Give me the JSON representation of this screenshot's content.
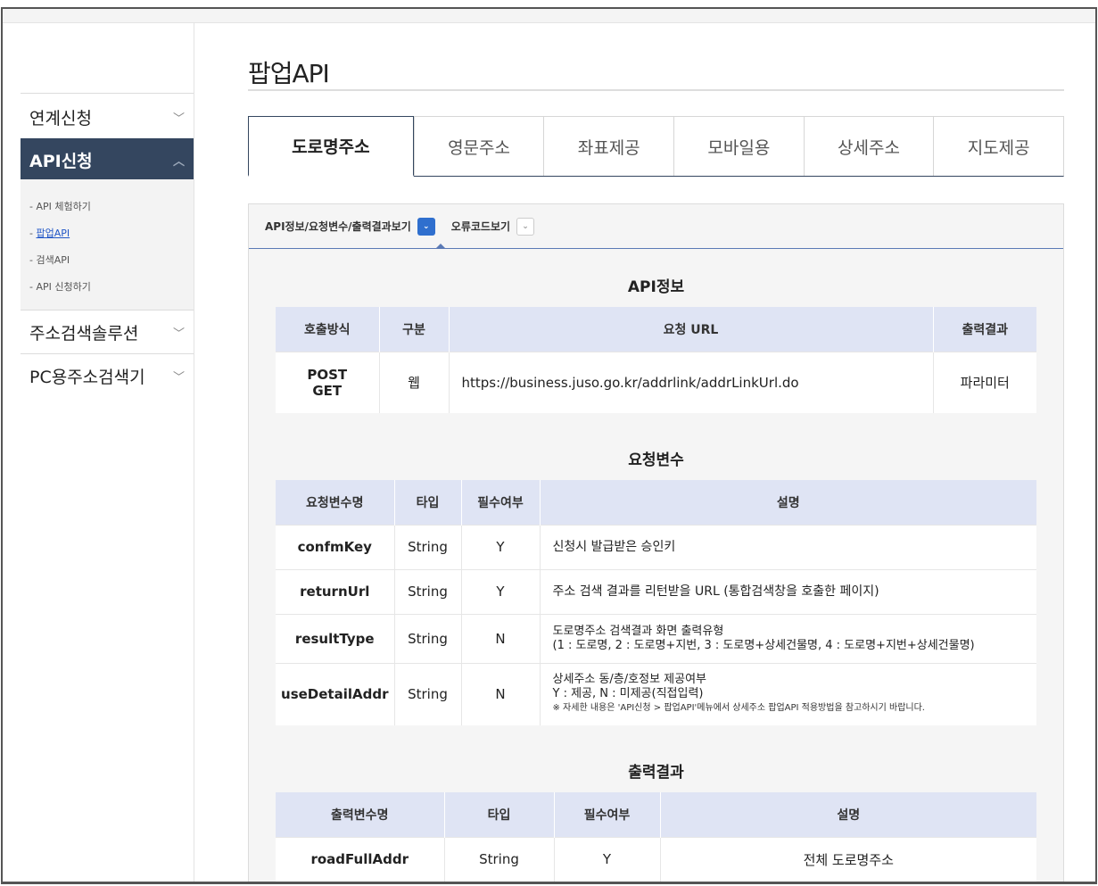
{
  "sidebar": {
    "menu": [
      {
        "label": "연계신청",
        "chevron": "﹀"
      },
      {
        "label": "API신청",
        "chevron": "︿"
      },
      {
        "label": "주소검색솔루션",
        "chevron": "﹀"
      },
      {
        "label": "PC용주소검색기",
        "chevron": "﹀"
      }
    ],
    "sub_marker": "-",
    "submenu": [
      "API 체험하기",
      "팝업API",
      "검색API",
      "API 신청하기"
    ]
  },
  "page": {
    "title": "팝업API"
  },
  "tabs": [
    "도로명주소",
    "영문주소",
    "좌표제공",
    "모바일용",
    "상세주소",
    "지도제공"
  ],
  "panel": {
    "head_items": [
      "API정보/요청변수/출력결과보기",
      "오류코드보기"
    ],
    "head_toggles": [
      "⌄",
      "⌄"
    ]
  },
  "api_info": {
    "title": "API정보",
    "headers": [
      "호출방식",
      "구분",
      "요청 URL",
      "출력결과"
    ],
    "row": {
      "method_1": "POST",
      "method_2": "GET",
      "type": "웹",
      "url": "https://business.juso.go.kr/addrlink/addrLinkUrl.do",
      "output": "파라미터"
    }
  },
  "request_vars": {
    "title": "요청변수",
    "headers": [
      "요청변수명",
      "타입",
      "필수여부",
      "설명"
    ],
    "rows": [
      {
        "name": "confmKey",
        "type": "String",
        "required": "Y",
        "desc": "신청시 발급받은 승인키"
      },
      {
        "name": "returnUrl",
        "type": "String",
        "required": "Y",
        "desc": "주소 검색 결과를 리턴받을 URL (통합검색창을 호출한 페이지)"
      },
      {
        "name": "resultType",
        "type": "String",
        "required": "N",
        "desc": "도로명주소 검색결과 화면 출력유형",
        "desc2": "(1 : 도로명, 2 : 도로명+지번, 3 : 도로명+상세건물명, 4 : 도로명+지번+상세건물명)"
      },
      {
        "name": "useDetailAddr",
        "type": "String",
        "required": "N",
        "desc": "상세주소 동/층/호정보 제공여부",
        "desc2": "Y : 제공, N : 미제공(직접입력)",
        "note": "※ 자세한 내용은 'API신청 > 팝업API'메뉴에서 상세주소 팝업API 적용방법을 참고하시기 바랍니다."
      }
    ]
  },
  "output": {
    "title": "출력결과",
    "headers": [
      "출력변수명",
      "타입",
      "필수여부",
      "설명"
    ],
    "rows": [
      {
        "name": "roadFullAddr",
        "type": "String",
        "required": "Y",
        "desc": "전체 도로명주소"
      }
    ]
  }
}
